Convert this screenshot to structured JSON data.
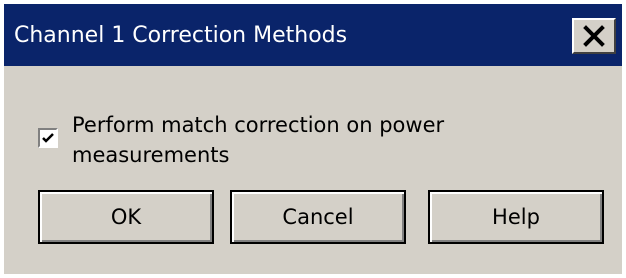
{
  "window": {
    "title": "Channel 1 Correction Methods",
    "close_icon": "close-icon"
  },
  "options": {
    "match_correction": {
      "label": "Perform match correction on power measurements",
      "checked": true
    }
  },
  "buttons": {
    "ok_label": "OK",
    "cancel_label": "Cancel",
    "help_label": "Help"
  },
  "colors": {
    "titlebar": "#0a246a",
    "dialog_background": "#d4d0c8",
    "title_text": "#ffffff"
  }
}
